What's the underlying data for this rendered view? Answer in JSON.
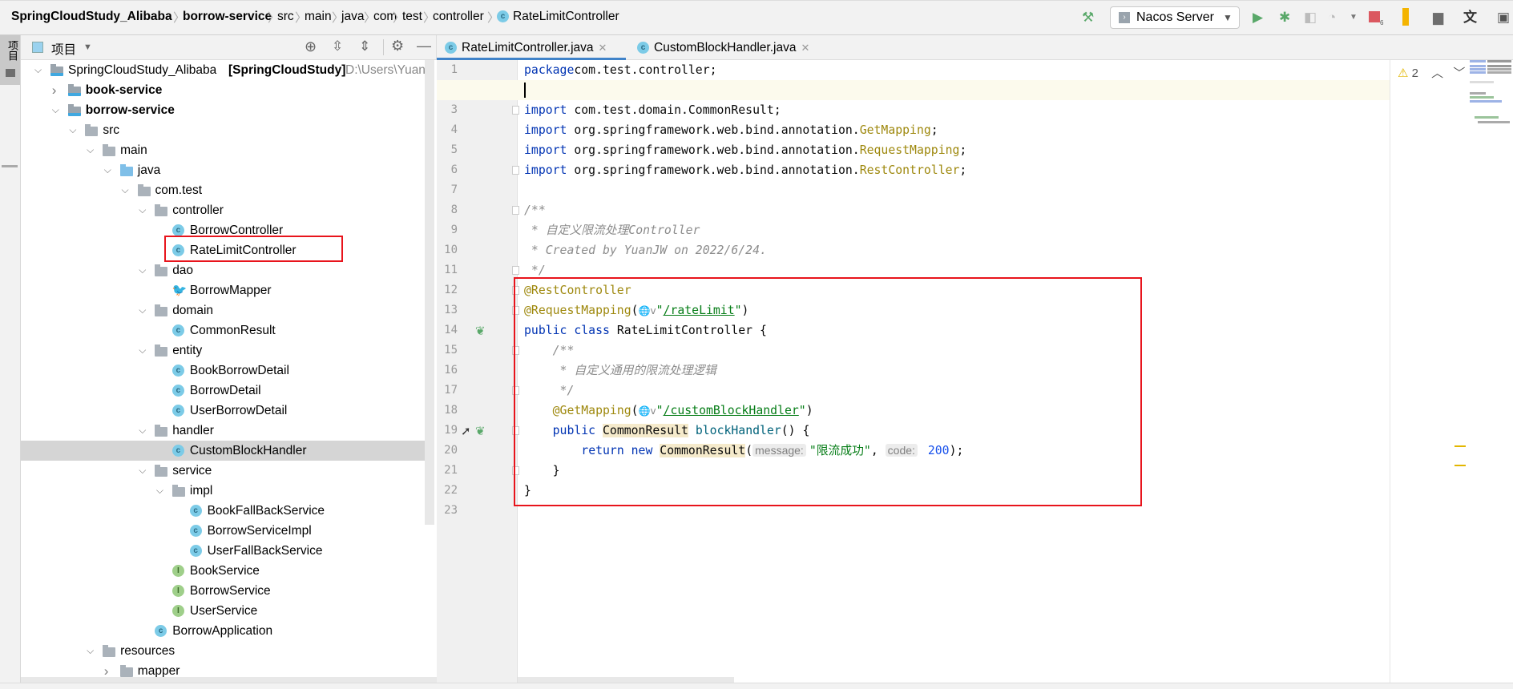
{
  "breadcrumb": [
    "SpringCloudStudy_Alibaba",
    "borrow-service",
    "src",
    "main",
    "java",
    "com",
    "test",
    "controller",
    "RateLimitController"
  ],
  "toolbar": {
    "run_config": "Nacos Server",
    "icons": [
      "hammer-icon",
      "run-icon",
      "debug-icon",
      "coverage-icon",
      "profile-icon",
      "stop-icon",
      "vcs-update-icon",
      "project-structure-icon",
      "translate-icon",
      "presentation-icon"
    ],
    "stop_badge": "6"
  },
  "left_strip": {
    "project_tab": "项目"
  },
  "project_panel": {
    "title": "项目"
  },
  "tree": [
    {
      "label": "SpringCloudStudy_Alibaba",
      "suffix": "[SpringCloudStudy]",
      "path": "D:\\Users\\YuanJ",
      "level": 0,
      "expanded": true,
      "icon": "module"
    },
    {
      "label": "book-service",
      "level": 1,
      "expanded": false,
      "icon": "module",
      "bold": true
    },
    {
      "label": "borrow-service",
      "level": 1,
      "expanded": true,
      "icon": "module",
      "bold": true
    },
    {
      "label": "src",
      "level": 2,
      "expanded": true,
      "icon": "folder"
    },
    {
      "label": "main",
      "level": 3,
      "expanded": true,
      "icon": "folder"
    },
    {
      "label": "java",
      "level": 4,
      "expanded": true,
      "icon": "source-folder"
    },
    {
      "label": "com.test",
      "level": 5,
      "expanded": true,
      "icon": "package"
    },
    {
      "label": "controller",
      "level": 6,
      "expanded": true,
      "icon": "package"
    },
    {
      "label": "BorrowController",
      "level": 7,
      "icon": "class"
    },
    {
      "label": "RateLimitController",
      "level": 7,
      "icon": "class",
      "boxed": true
    },
    {
      "label": "dao",
      "level": 6,
      "expanded": true,
      "icon": "package"
    },
    {
      "label": "BorrowMapper",
      "level": 7,
      "icon": "mybatis"
    },
    {
      "label": "domain",
      "level": 6,
      "expanded": true,
      "icon": "package"
    },
    {
      "label": "CommonResult",
      "level": 7,
      "icon": "class"
    },
    {
      "label": "entity",
      "level": 6,
      "expanded": true,
      "icon": "package"
    },
    {
      "label": "BookBorrowDetail",
      "level": 7,
      "icon": "class"
    },
    {
      "label": "BorrowDetail",
      "level": 7,
      "icon": "class"
    },
    {
      "label": "UserBorrowDetail",
      "level": 7,
      "icon": "class"
    },
    {
      "label": "handler",
      "level": 6,
      "expanded": true,
      "icon": "package"
    },
    {
      "label": "CustomBlockHandler",
      "level": 7,
      "icon": "class",
      "selected": true
    },
    {
      "label": "service",
      "level": 6,
      "expanded": true,
      "icon": "package"
    },
    {
      "label": "impl",
      "level": 7,
      "expanded": true,
      "icon": "package"
    },
    {
      "label": "BookFallBackService",
      "level": 8,
      "icon": "class"
    },
    {
      "label": "BorrowServiceImpl",
      "level": 8,
      "icon": "class"
    },
    {
      "label": "UserFallBackService",
      "level": 8,
      "icon": "class"
    },
    {
      "label": "BookService",
      "level": 7,
      "icon": "interface"
    },
    {
      "label": "BorrowService",
      "level": 7,
      "icon": "interface"
    },
    {
      "label": "UserService",
      "level": 7,
      "icon": "interface"
    },
    {
      "label": "BorrowApplication",
      "level": 6,
      "icon": "spring-boot-class"
    },
    {
      "label": "resources",
      "level": 3,
      "expanded": true,
      "icon": "resources"
    },
    {
      "label": "mapper",
      "level": 4,
      "expanded": false,
      "icon": "folder"
    }
  ],
  "editor_tabs": [
    {
      "label": "RateLimitController.java",
      "active": true
    },
    {
      "label": "CustomBlockHandler.java",
      "active": false
    }
  ],
  "inspection": {
    "warnings": "2"
  },
  "code": [
    [
      [
        "kw",
        "package"
      ],
      [
        "",
        "com.test.controller;"
      ]
    ],
    [],
    [
      [
        "kw",
        "import"
      ],
      [
        "",
        " com.test.domain.CommonResult;"
      ]
    ],
    [
      [
        "kw",
        "import"
      ],
      [
        "",
        " org.springframework.web.bind.annotation."
      ],
      [
        "an",
        "GetMapping"
      ],
      [
        "",
        ";"
      ]
    ],
    [
      [
        "kw",
        "import"
      ],
      [
        "",
        " org.springframework.web.bind.annotation."
      ],
      [
        "an",
        "RequestMapping"
      ],
      [
        "",
        ";"
      ]
    ],
    [
      [
        "kw",
        "import"
      ],
      [
        "",
        " org.springframework.web.bind.annotation."
      ],
      [
        "an",
        "RestController"
      ],
      [
        "",
        ";"
      ]
    ],
    [],
    [
      [
        "cm",
        "/**"
      ]
    ],
    [
      [
        "cm",
        " * 自定义限流处理Controller"
      ]
    ],
    [
      [
        "cm",
        " * Created by YuanJW on 2022/6/24."
      ]
    ],
    [
      [
        "cm",
        " */"
      ]
    ],
    [
      [
        "an",
        "@RestController"
      ]
    ],
    [
      [
        "an",
        "@RequestMapping"
      ],
      [
        "",
        "("
      ],
      [
        "globe",
        "🌐v"
      ],
      [
        "st",
        "\""
      ],
      [
        "url",
        "/rateLimit"
      ],
      [
        "st",
        "\""
      ],
      [
        "",
        ")"
      ]
    ],
    [
      [
        "kw",
        "public class"
      ],
      [
        "",
        " RateLimitController {"
      ]
    ],
    [
      [
        "cm",
        "    /**"
      ]
    ],
    [
      [
        "cm",
        "     * 自定义通用的限流处理逻辑"
      ]
    ],
    [
      [
        "cm",
        "     */"
      ]
    ],
    [
      [
        "",
        "    "
      ],
      [
        "an",
        "@GetMapping"
      ],
      [
        "",
        "("
      ],
      [
        "globe",
        "🌐v"
      ],
      [
        "st",
        "\""
      ],
      [
        "url",
        "/customBlockHandler"
      ],
      [
        "st",
        "\""
      ],
      [
        "",
        ")"
      ]
    ],
    [
      [
        "",
        "    "
      ],
      [
        "kw",
        "public"
      ],
      [
        "",
        " "
      ],
      [
        "hl",
        "CommonResult"
      ],
      [
        "",
        " "
      ],
      [
        "md",
        "blockHandler"
      ],
      [
        "",
        "() {"
      ]
    ],
    [
      [
        "",
        "        "
      ],
      [
        "kw",
        "return new"
      ],
      [
        "",
        " "
      ],
      [
        "hl",
        "CommonResult"
      ],
      [
        "",
        "("
      ],
      [
        "hint",
        "message:"
      ],
      [
        "st",
        "\"限流成功\""
      ],
      [
        "",
        ", "
      ],
      [
        "hint",
        "code:"
      ],
      [
        "nm",
        " 200"
      ],
      [
        "",
        ");"
      ]
    ],
    [
      [
        "",
        "    }"
      ]
    ],
    [
      [
        "",
        "}"
      ]
    ],
    []
  ]
}
